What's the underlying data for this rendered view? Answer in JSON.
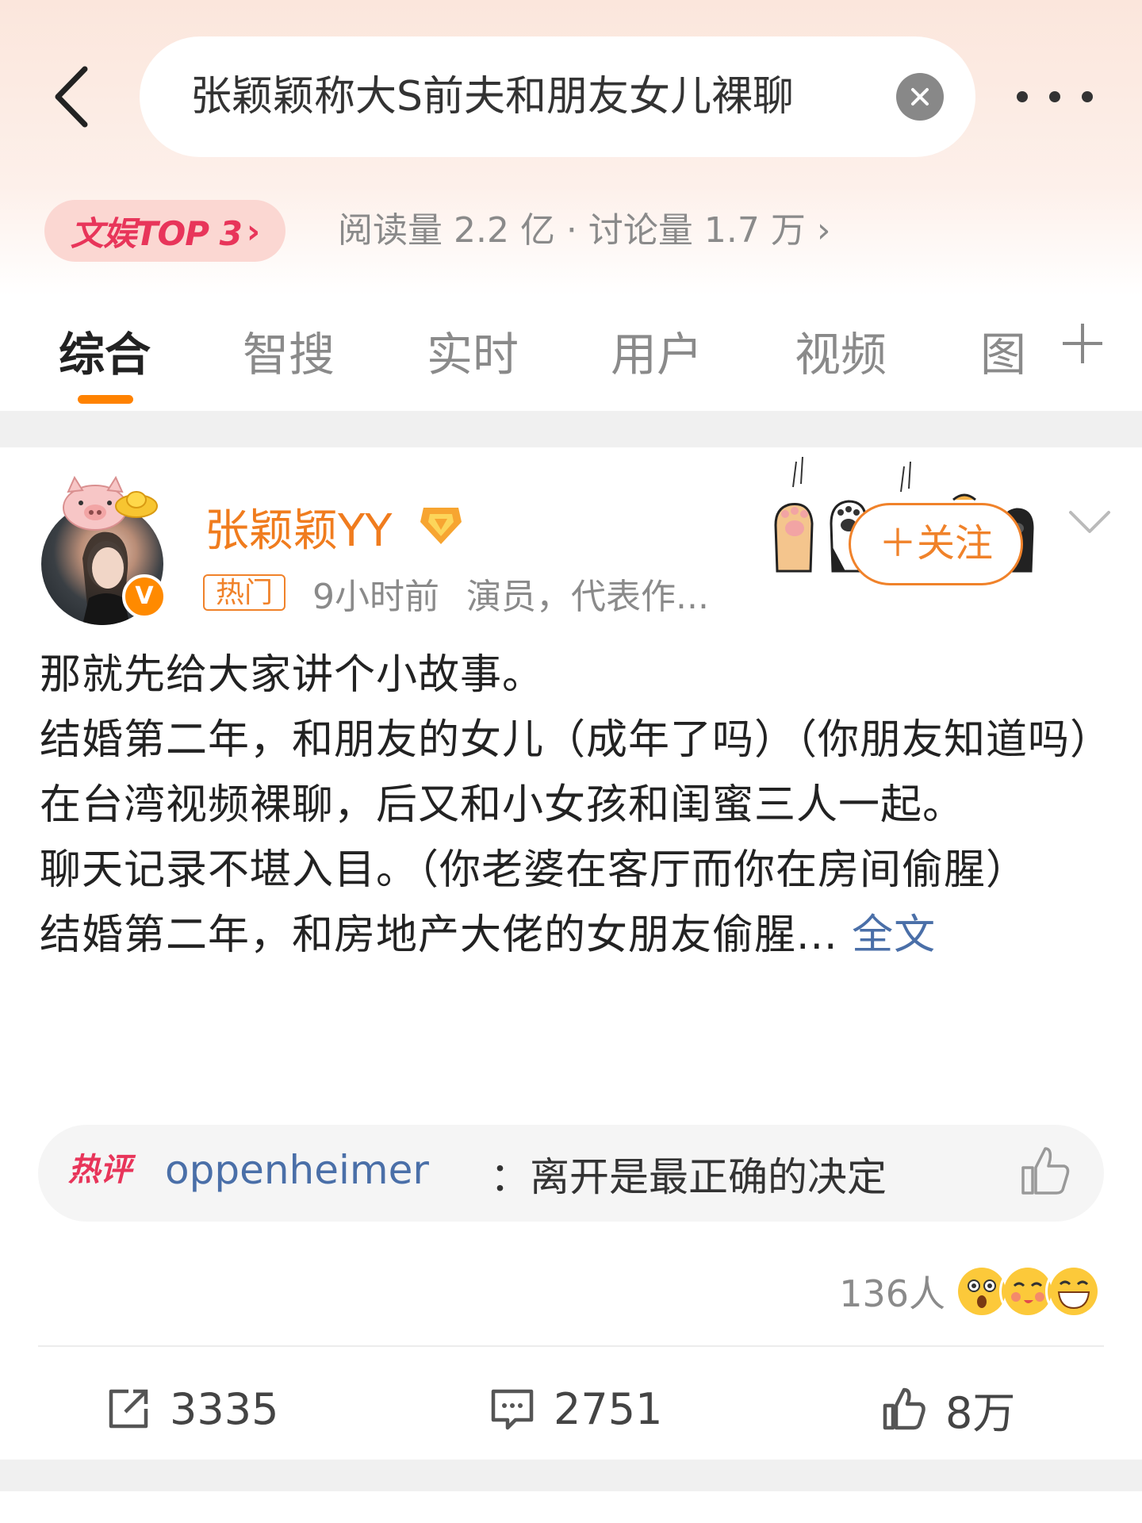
{
  "header": {
    "search_query": "张颖颖称大S前夫和朋友女儿裸聊",
    "rank_badge": "文娱TOP 3",
    "stats": "阅读量 2.2 亿 · 讨论量 1.7 万"
  },
  "tabs": [
    "综合",
    "智搜",
    "实时",
    "用户",
    "视频",
    "图"
  ],
  "post": {
    "username": "张颖颖YY",
    "hot_tag": "热门",
    "time": "9小时前",
    "profile": "演员，代表作...",
    "follow_label": "＋关注",
    "verified_letter": "V",
    "lines": [
      "那就先给大家讲个小故事。",
      "结婚第二年，和朋友的女儿（成年了吗）（你朋友知道吗）在台湾视频裸聊，后又和小女孩和闺蜜三人一起。",
      "聊天记录不堪入目。（你老婆在客厅而你在房间偷腥）",
      "结婚第二年，和房地产大佬的女朋友偷腥..."
    ],
    "full_text_link": "全文",
    "hot_comment": {
      "label": "热评",
      "user": "oppenheimer",
      "text": "：离开是最正确的决定"
    },
    "reactions_count": "136人",
    "actions": {
      "repost": "3335",
      "comment": "2751",
      "like": "8万"
    }
  },
  "colors": {
    "accent_orange": "#ff8200",
    "username_orange": "#f07c1e",
    "link_blue": "#4a6fa8",
    "hot_red": "#e8355a"
  }
}
